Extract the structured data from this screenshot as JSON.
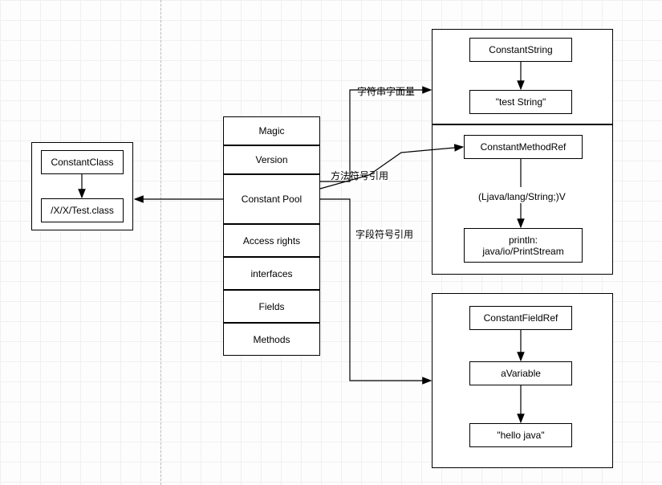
{
  "leftGroup": {
    "top": "ConstantClass",
    "bottom": "/X/X/Test.class"
  },
  "centerItems": [
    "Magic",
    "Version",
    "Constant Pool",
    "Access rights",
    "interfaces",
    "Fields",
    "Methods"
  ],
  "group1": {
    "top": "ConstantString",
    "bottom": "\"test String\""
  },
  "group2": {
    "top": "ConstantMethodRef",
    "mid": "(Ljava/lang/String;)V",
    "bottom": "println:\njava/io/PrintStream"
  },
  "group3": {
    "top": "ConstantFieldRef",
    "mid": "aVariable",
    "bottom": "\"hello java\""
  },
  "labels": {
    "str": "字符串字面量",
    "method": "方法符号引用",
    "field": "字段符号引用"
  }
}
